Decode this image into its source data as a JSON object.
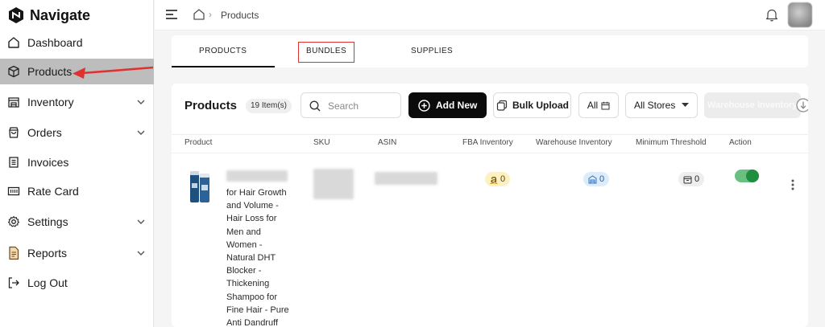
{
  "brand": {
    "name": "Navigate"
  },
  "sidebar": {
    "items": [
      {
        "label": "Dashboard",
        "icon": "home-icon",
        "active": false,
        "expandable": false
      },
      {
        "label": "Products",
        "icon": "box-icon",
        "active": true,
        "expandable": false
      },
      {
        "label": "Inventory",
        "icon": "warehouse-icon",
        "active": false,
        "expandable": true
      },
      {
        "label": "Orders",
        "icon": "bag-icon",
        "active": false,
        "expandable": true
      },
      {
        "label": "Invoices",
        "icon": "invoice-icon",
        "active": false,
        "expandable": false
      },
      {
        "label": "Rate Card",
        "icon": "rate-card-icon",
        "active": false,
        "expandable": false
      },
      {
        "label": "Settings",
        "icon": "gear-icon",
        "active": false,
        "expandable": true
      },
      {
        "label": "Reports",
        "icon": "report-icon",
        "active": false,
        "expandable": true
      },
      {
        "label": "Log Out",
        "icon": "logout-icon",
        "active": false,
        "expandable": false
      }
    ]
  },
  "header": {
    "breadcrumb_current": "Products",
    "breadcrumb_sep": "›"
  },
  "tabs": [
    {
      "label": "PRODUCTS",
      "active": true
    },
    {
      "label": "BUNDLES",
      "active": false,
      "highlighted": true
    },
    {
      "label": "SUPPLIES",
      "active": false
    }
  ],
  "products": {
    "title": "Products",
    "count_badge": "19 Item(s)",
    "search_placeholder": "Search",
    "add_new_label": "Add New",
    "bulk_upload_label": "Bulk Upload",
    "date_filter_label": "All",
    "stores_filter_label": "All Stores",
    "warehouse_filter_label": "Warehouse Inventory",
    "columns": [
      "Product",
      "SKU",
      "ASIN",
      "FBA Inventory",
      "Warehouse Inventory",
      "Minimum Threshold",
      "Action"
    ],
    "rows": [
      {
        "name_lines": [
          "for Hair Growth",
          "and Volume -",
          "Hair Loss for",
          "Men and",
          "Women -",
          "Natural DHT",
          "Blocker -",
          "Thickening",
          "Shampoo for",
          "Fine Hair - Pure",
          "Anti Dandruff"
        ],
        "fba_inventory": "0",
        "warehouse_inventory": "0",
        "minimum_threshold": "0",
        "enabled": true
      }
    ]
  },
  "colors": {
    "accent": "#0b0b0b",
    "active_nav": "#bdbdbd",
    "highlight_red": "#e03131",
    "toggle_green": "#1f8f3f"
  }
}
